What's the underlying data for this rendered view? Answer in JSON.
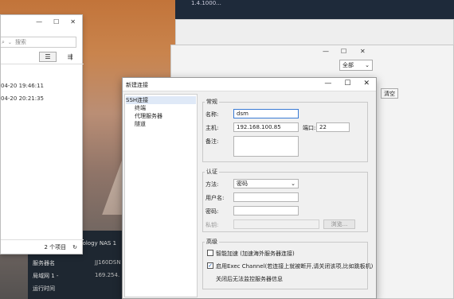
{
  "explorer": {
    "search_placeholder": "搜索",
    "rows": [
      "04-20 19:46:11",
      "04-20 20:21:35"
    ],
    "item_count": "2 个项目",
    "refresh_icon": "↻"
  },
  "darkwin": {
    "text": "1.4.1000..."
  },
  "backwin": {
    "filter_value": "全部",
    "clear_label": "清空"
  },
  "synology": {
    "brand": "ynology NAS 1",
    "server_name_label": "服务器名",
    "server_name_value": "JJ160DSN",
    "lan_label": "局域网 1 -",
    "lan_value": "169.254.",
    "uptime_label": "运行时间"
  },
  "dialog": {
    "title": "新建连接",
    "tree": {
      "root": "SSH连接",
      "children": [
        "终端",
        "代理服务器",
        "隧道"
      ]
    },
    "general": {
      "group_label": "常规",
      "name_label": "名称:",
      "name_value": "dsm",
      "host_label": "主机:",
      "host_value": "192.168.100.85",
      "port_label": "端口:",
      "port_value": "22",
      "note_label": "备注:"
    },
    "auth": {
      "group_label": "认证",
      "method_label": "方法:",
      "method_value": "密码",
      "user_label": "用户名:",
      "password_label": "密码:",
      "key_label": "私钥:",
      "browse_label": "浏览..."
    },
    "advanced": {
      "group_label": "高级",
      "smart_accel": "智能加速 (加速海外服务器连接)",
      "exec_channel": "启用Exec Channel(若连接上就被断开,请关闭该项,比如跳板机)",
      "exec_note": "关闭后无法监控服务器信息"
    }
  }
}
